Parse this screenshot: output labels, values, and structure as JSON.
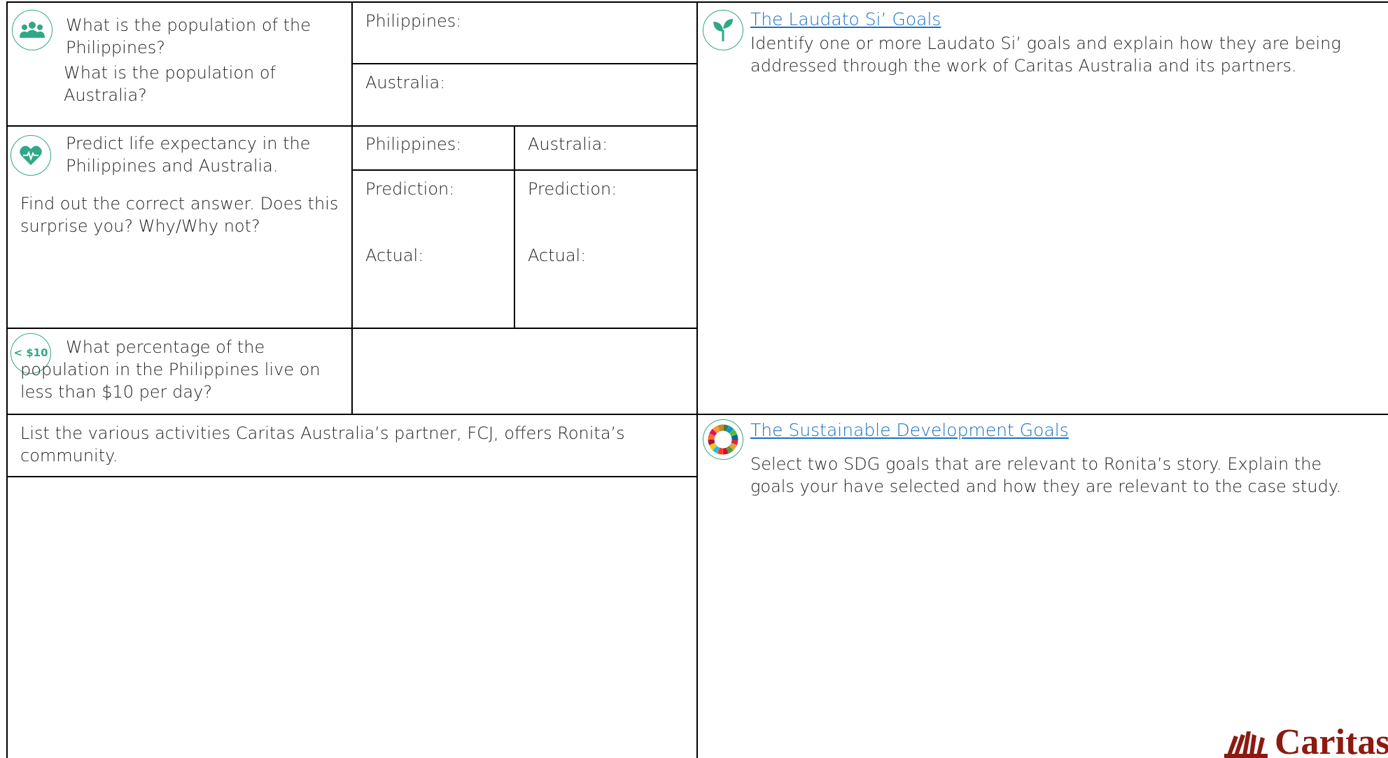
{
  "population": {
    "question_philippines": "What is the population of the Philippines?",
    "question_australia": "What is the population of Australia?",
    "philippines_label": "Philippines:",
    "australia_label": "Australia:"
  },
  "life_expectancy": {
    "question": "Predict life expectancy in the Philippines and Australia.",
    "followup": "Find out the correct answer. Does this surprise you? Why/Why not?",
    "philippines_label": "Philippines:",
    "australia_label": "Australia:",
    "prediction_label": "Prediction:",
    "actual_label": "Actual:"
  },
  "poverty": {
    "icon_text": "< $10",
    "question": "What percentage of the population in the Philippines live on less than $10 per day?"
  },
  "activities": {
    "prompt": "List the various activities Caritas Australia’s partner, FCJ, offers Ronita’s community."
  },
  "laudato": {
    "title": "The Laudato Si’ Goals",
    "text": "Identify one or more Laudato Si’ goals and explain how they are being addressed through the work of Caritas Australia and its partners."
  },
  "sdg": {
    "title": "The Sustainable Development Goals",
    "text": "Select two SDG goals that are relevant to Ronita’s story. Explain the goals your have selected and how they are relevant to the case study."
  },
  "logo": {
    "text": "Caritas"
  },
  "colors": {
    "icon_green": "#2fa887",
    "link_blue": "#1a6fc4",
    "logo_red": "#8b1a10"
  }
}
